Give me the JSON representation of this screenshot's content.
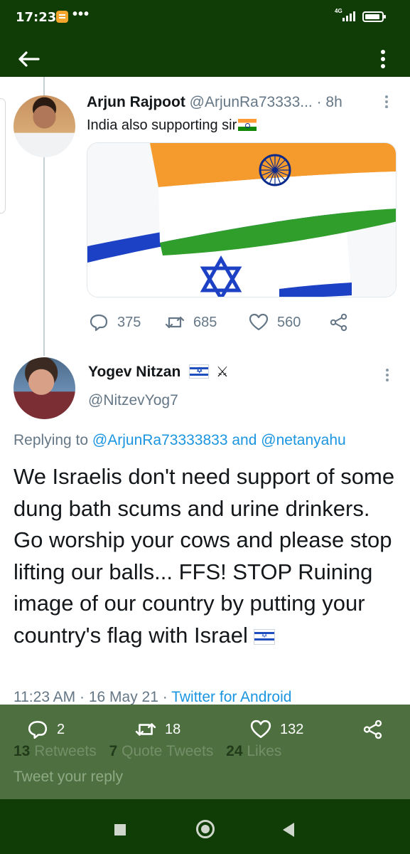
{
  "status_bar": {
    "time": "17:23",
    "overflow": "•••",
    "network": "4G",
    "icons": [
      "notification-icon",
      "signal-icon",
      "battery-icon"
    ]
  },
  "app_bar": {
    "back_icon": "arrow-left-icon",
    "more_icon": "more-vertical-icon"
  },
  "tweet_parent": {
    "name": "Arjun Rajpoot",
    "handle": "@ArjunRa73333...",
    "time": "· 8h",
    "text": "India also supporting sir",
    "media": "india-israel-flags-image",
    "replies": "375",
    "retweets": "685",
    "likes": "560"
  },
  "tweet_main": {
    "name": "Yogev Nitzan",
    "handle": "@NitzevYog7",
    "replying_prefix": "Replying to",
    "replying_user1": "@ArjunRa73333833",
    "replying_and": "and",
    "replying_user2": "@netanyahu",
    "text": "We Israelis don't need support of some dung bath scums and urine drinkers. Go worship your cows and please stop lifting our balls... FFS! STOP Ruining image of our country by putting your country's flag with Israel",
    "timestamp": "11:23 AM · 16 May 21 ·",
    "source": "Twitter for Android",
    "replies": "2",
    "retweets": "18",
    "likes": "132",
    "retweets_count": "13",
    "retweets_label": "Retweets",
    "quotes_count": "7",
    "quotes_label": "Quote Tweets",
    "likes_count": "24",
    "likes_label": "Likes"
  },
  "reply": {
    "placeholder": "Tweet your reply"
  },
  "colors": {
    "system_bar": "#0f3d05",
    "overlay": "#4e7040",
    "link": "#1b95e0",
    "muted": "#657786"
  }
}
